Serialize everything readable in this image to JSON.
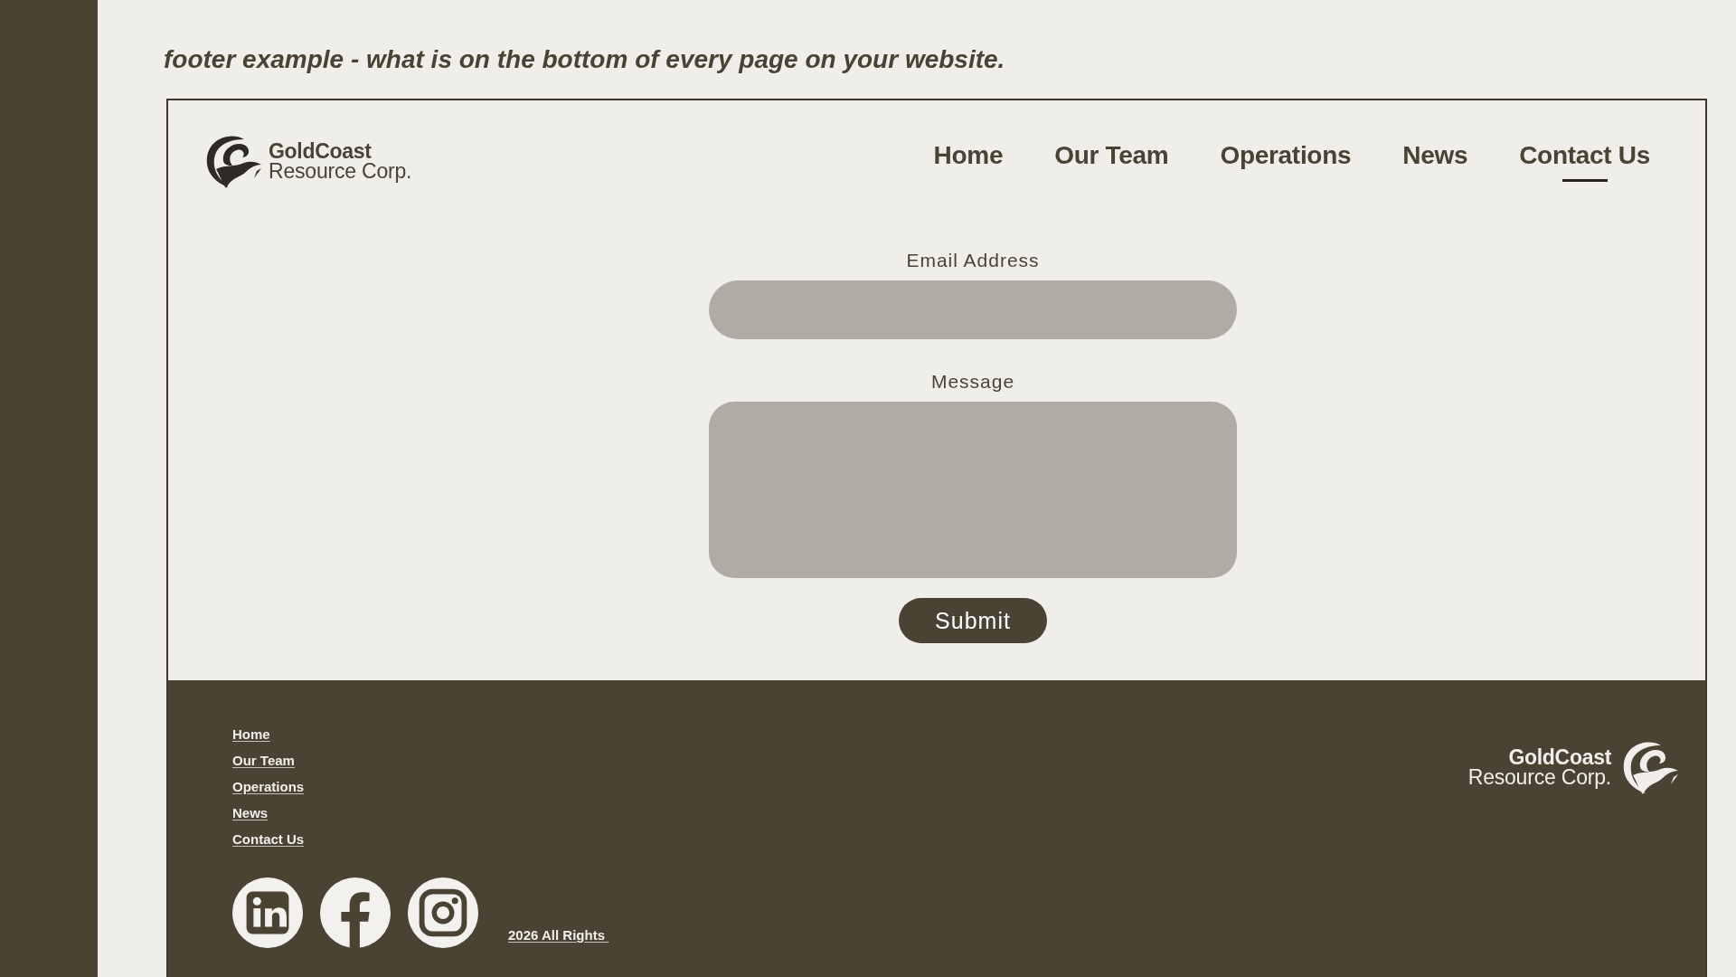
{
  "caption": "footer example - what is on the bottom of every page on your website.",
  "site": {
    "logo": {
      "name": "GoldCoast",
      "tagline": "Resource Corp."
    },
    "nav": [
      {
        "label": "Home",
        "selected": false
      },
      {
        "label": "Our Team",
        "selected": false
      },
      {
        "label": "Operations",
        "selected": false
      },
      {
        "label": "News",
        "selected": false
      },
      {
        "label": "Contact Us",
        "selected": true
      }
    ],
    "form": {
      "fields": [
        {
          "kind": "input",
          "label": "Email Address"
        },
        {
          "kind": "textarea",
          "label": "Message"
        }
      ],
      "submit": "Submit"
    },
    "footer": {
      "links": [
        "Home",
        "Our Team",
        "Operations",
        "News",
        "Contact Us"
      ],
      "social": [
        {
          "kind": "linkedin"
        },
        {
          "kind": "facebook"
        },
        {
          "kind": "instagram"
        }
      ],
      "copyright": "2026 All Rights ",
      "logo": {
        "name": "GoldCoast",
        "tagline": "Resource Corp."
      }
    }
  }
}
